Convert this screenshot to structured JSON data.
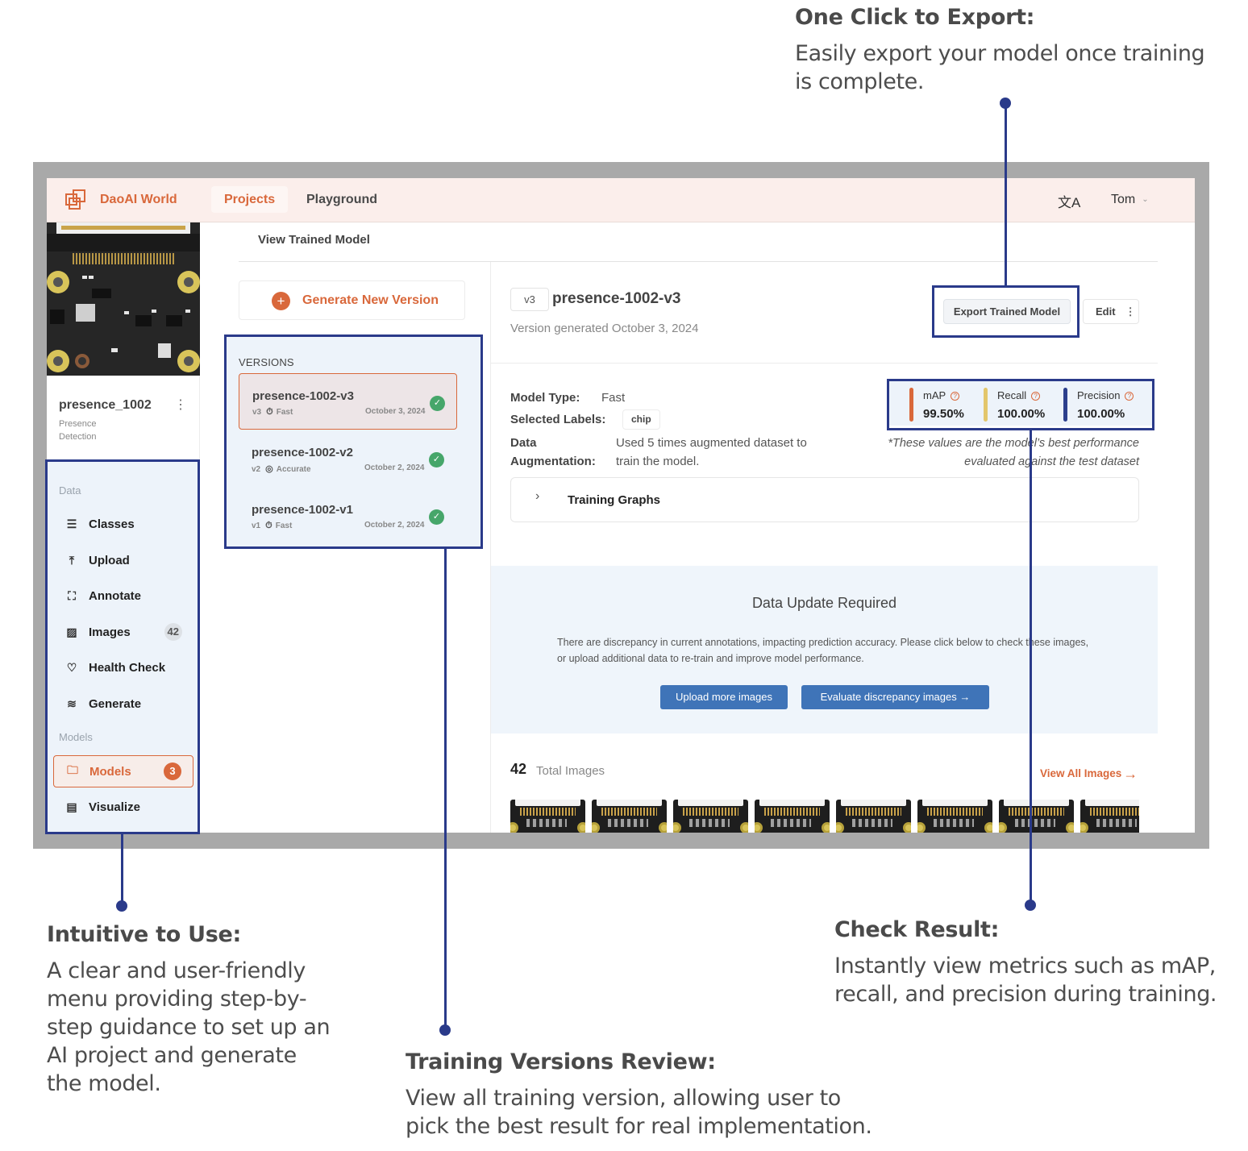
{
  "callouts": {
    "export": {
      "title": "One Click to Export:",
      "body": "Easily export your model once training is complete."
    },
    "intuitive": {
      "title": "Intuitive to Use:",
      "body": "A clear and user-friendly menu providing step-by-step guidance to set up an AI project and generate the model."
    },
    "versions": {
      "title": "Training Versions Review:",
      "body": "View all training version, allowing user to pick the best result for real implementation."
    },
    "results": {
      "title": "Check Result:",
      "body": "Instantly view metrics such as mAP, recall, and precision during training."
    }
  },
  "app": {
    "brand": "DaoAI World",
    "logo_icon": "overlapping-squares-logo",
    "nav_tabs": [
      {
        "label": "Projects",
        "active": true
      },
      {
        "label": "Playground",
        "active": false
      }
    ],
    "language_icon": "translate-icon",
    "language_glyph": "文A",
    "user_name": "Tom",
    "accent_color": "#d9683b"
  },
  "project": {
    "name": "presence_1002",
    "type": "Presence Detection",
    "kebab": "⋮"
  },
  "sidebar": {
    "sections": [
      {
        "label": "Data",
        "items": [
          {
            "label": "Classes",
            "icon": "list-icon",
            "glyph": "☰"
          },
          {
            "label": "Upload",
            "icon": "upload-icon",
            "glyph": "⤒"
          },
          {
            "label": "Annotate",
            "icon": "annotate-icon",
            "glyph": "⛶"
          },
          {
            "label": "Images",
            "icon": "images-icon",
            "glyph": "▨",
            "badge": "42"
          },
          {
            "label": "Health Check",
            "icon": "heart-pulse-icon",
            "glyph": "♡"
          },
          {
            "label": "Generate",
            "icon": "layers-icon",
            "glyph": "≋"
          }
        ]
      },
      {
        "label": "Models",
        "items": [
          {
            "label": "Models",
            "icon": "folder-icon",
            "glyph": "🗀",
            "badge": "3",
            "active": true
          },
          {
            "label": "Visualize",
            "icon": "document-icon",
            "glyph": "▤"
          }
        ]
      }
    ]
  },
  "page": {
    "title": "View Trained Model",
    "generate_button": "Generate New Version",
    "generate_glyph": "+"
  },
  "versions": {
    "label": "VERSIONS",
    "items": [
      {
        "name": "presence-1002-v3",
        "tag": "v3",
        "type": "Fast",
        "type_icon": "stopwatch-fast-icon",
        "type_glyph": "⏱",
        "date": "October 3, 2024",
        "status": "completed",
        "selected": true
      },
      {
        "name": "presence-1002-v2",
        "tag": "v2",
        "type": "Accurate",
        "type_icon": "target-icon",
        "type_glyph": "◎",
        "date": "October 2, 2024",
        "status": "completed",
        "selected": false
      },
      {
        "name": "presence-1002-v1",
        "tag": "v1",
        "type": "Fast",
        "type_icon": "stopwatch-fast-icon",
        "type_glyph": "⏱",
        "date": "October 2, 2024",
        "status": "completed",
        "selected": false
      }
    ],
    "check_glyph": "✓"
  },
  "detail": {
    "tag": "v3",
    "title": "presence-1002-v3",
    "subtitle": "Version generated October 3, 2024",
    "export_button": "Export Trained Model",
    "edit_button": "Edit",
    "edit_kebab": "⋮",
    "model_type_label": "Model Type:",
    "model_type_value": "Fast",
    "labels_label": "Selected Labels:",
    "labels": [
      "chip"
    ],
    "augmentation_label_1": "Data",
    "augmentation_label_2": "Augmentation:",
    "augmentation_value_1": "Used 5 times augmented dataset to",
    "augmentation_value_2": "train the model.",
    "metrics": [
      {
        "label": "mAP",
        "value": "99.50%",
        "color": "#d9683b"
      },
      {
        "label": "Recall",
        "value": "100.00%",
        "color": "#e3c66b"
      },
      {
        "label": "Precision",
        "value": "100.00%",
        "color": "#2c3f8c"
      }
    ],
    "help_glyph": "?",
    "metrics_note_1": "*These values are the model’s best performance",
    "metrics_note_2": "evaluated against the test dataset",
    "training_graphs_label": "Training Graphs",
    "training_graphs_chevron": "›"
  },
  "alert": {
    "title": "Data Update Required",
    "message": "There are discrepancy in current annotations, impacting prediction accuracy. Please click below to check these images, or upload additional data to re-train and improve model performance.",
    "upload_button": "Upload more images",
    "evaluate_button": "Evaluate discrepancy images  →"
  },
  "images": {
    "total": "42",
    "total_label": "Total Images",
    "view_all": "View All Images",
    "view_all_arrow": "→",
    "thumbnail_count": 8
  }
}
